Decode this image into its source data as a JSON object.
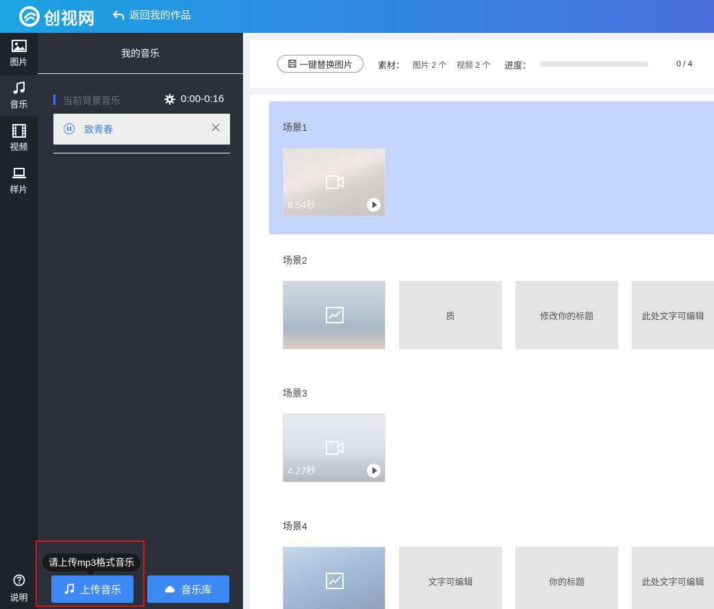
{
  "header": {
    "logo_text": "创视网",
    "back_label": "返回我的作品"
  },
  "rail": {
    "items": [
      {
        "label": "图片",
        "icon": "image-icon"
      },
      {
        "label": "音乐",
        "icon": "music-note-icon"
      },
      {
        "label": "视频",
        "icon": "film-icon"
      },
      {
        "label": "样片",
        "icon": "laptop-icon"
      }
    ],
    "help_label": "说明"
  },
  "music": {
    "title": "我的音乐",
    "bg_label": "当前背景音乐",
    "time_range": "0:00-0:16",
    "track_name": "致青春",
    "tooltip": "请上传mp3格式音乐",
    "upload_label": "上传音乐",
    "library_label": "音乐库"
  },
  "toolbar": {
    "replace_label": "一键替换图片",
    "material_label": "素材：",
    "images_count": "图片 2 个",
    "videos_count": "视频 2 个",
    "progress_label": "进度：",
    "progress_value": 0,
    "progress_text": "0 / 4"
  },
  "scenes": [
    {
      "title": "场景1",
      "thumb": {
        "kind": "video",
        "duration": "8.54秒"
      },
      "texts": []
    },
    {
      "title": "场景2",
      "thumb": {
        "kind": "image"
      },
      "texts": [
        "质",
        "修改你的标题",
        "此处文字可编辑"
      ]
    },
    {
      "title": "场景3",
      "thumb": {
        "kind": "video",
        "duration": "4.27秒"
      },
      "texts": []
    },
    {
      "title": "场景4",
      "thumb": {
        "kind": "image"
      },
      "texts": [
        "文字可编辑",
        "你的标题",
        "此处文字可编辑"
      ]
    }
  ],
  "colors": {
    "accent": "#3d8af5",
    "active_scene_bg": "#c4d5fc",
    "panel_bg": "#2b303a",
    "rail_bg": "#1f2329",
    "highlight_border": "#d21d1d"
  }
}
